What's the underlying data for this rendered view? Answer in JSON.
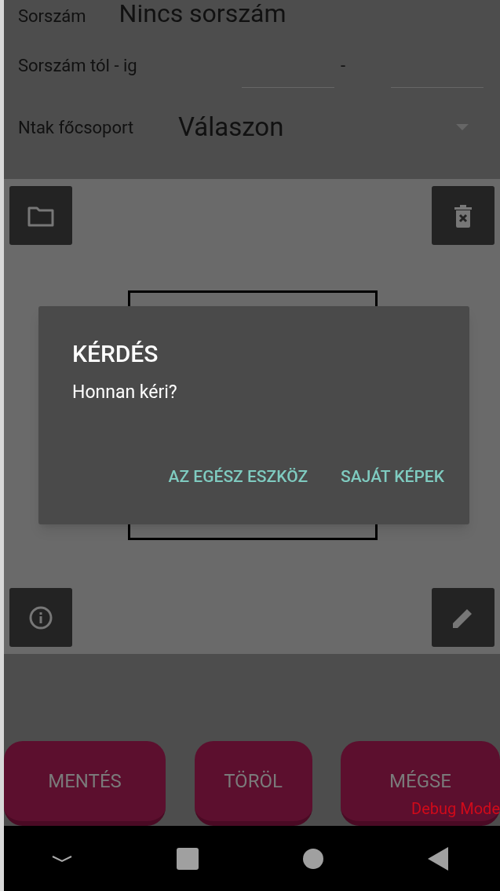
{
  "form": {
    "serial": {
      "label": "Sorszám",
      "value": "Nincs sorszám"
    },
    "range": {
      "label": "Sorszám tól - ig",
      "separator": "-"
    },
    "category": {
      "label": "Ntak főcsoport",
      "value": "Válaszon"
    }
  },
  "dialog": {
    "title": "KÉRDÉS",
    "message": "Honnan kéri?",
    "buttons": [
      "AZ EGÉSZ ESZKÖZ",
      "SAJÁT KÉPEK"
    ]
  },
  "actions": [
    "MENTÉS",
    "TÖRÖL",
    "MÉGSE"
  ],
  "debug_label": "Debug Mode"
}
